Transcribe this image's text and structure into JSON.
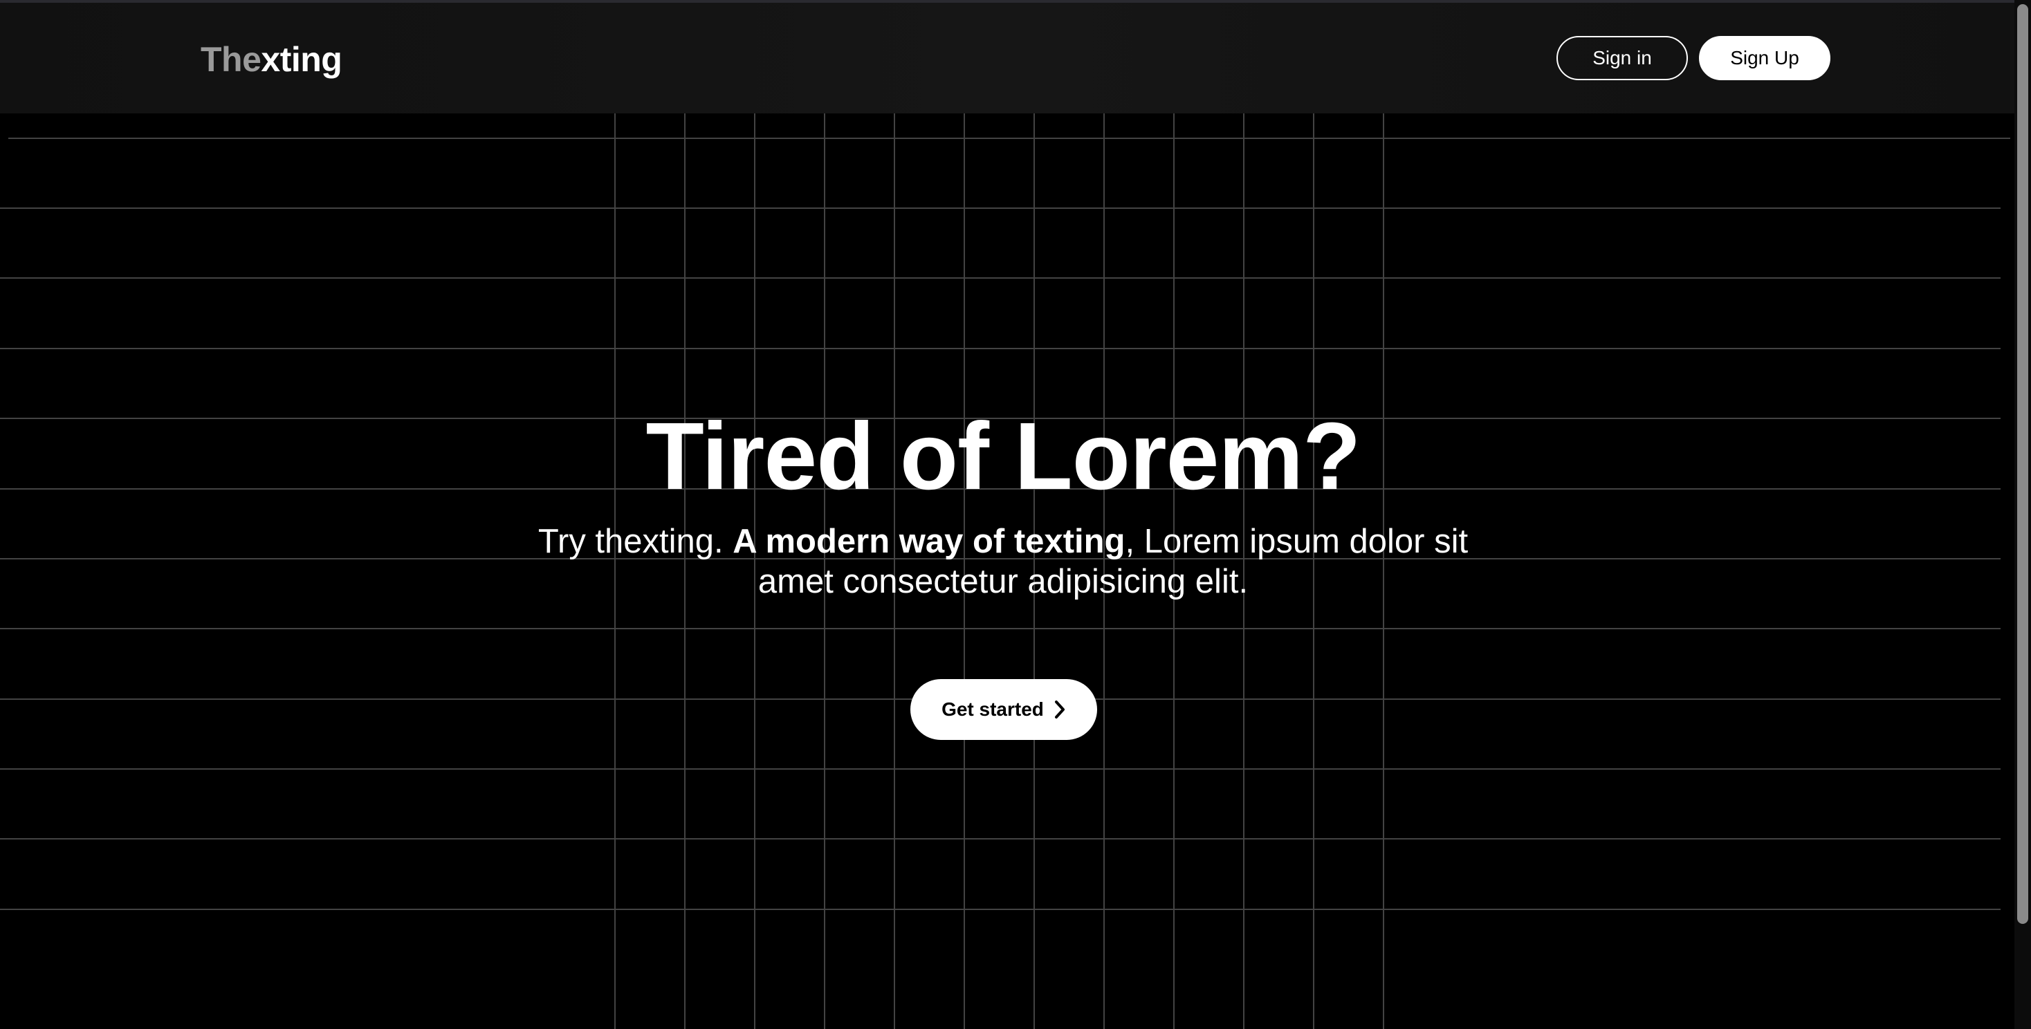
{
  "header": {
    "logo_prefix": "The",
    "logo_suffix": "xting",
    "sign_in_label": "Sign in",
    "sign_up_label": "Sign Up"
  },
  "hero": {
    "title": "Tired of Lorem?",
    "subtitle_lead": "Try thexting. ",
    "subtitle_bold": "A modern way of texting",
    "subtitle_rest": ", Lorem ipsum dolor sit amet consectetur adipisicing elit.",
    "cta_label": "Get started"
  },
  "icons": {
    "cta_icon": "chevron-right-icon"
  },
  "colors": {
    "background": "#000000",
    "navbar": "#141414",
    "text": "#ffffff",
    "logo_dim": "#9a9a9a",
    "grid_line": "#5a5a5a"
  }
}
